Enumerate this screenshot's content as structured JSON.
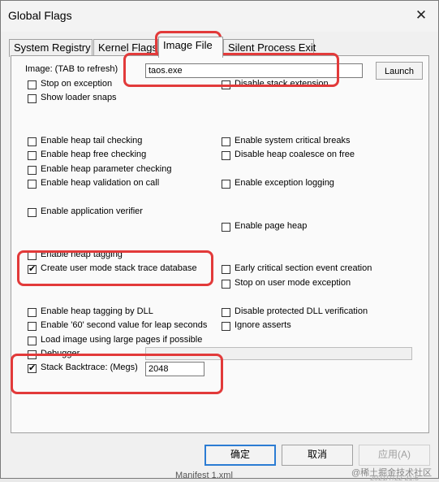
{
  "window": {
    "title": "Global Flags",
    "close_glyph": "✕"
  },
  "tabs": [
    {
      "label": "System Registry"
    },
    {
      "label": "Kernel Flags"
    },
    {
      "label": "Image File"
    },
    {
      "label": "Silent Process Exit"
    }
  ],
  "image": {
    "label": "Image: (TAB to refresh)",
    "value": "taos.exe",
    "launch": "Launch"
  },
  "flags": {
    "stop_on_exception": "Stop on exception",
    "show_loader_snaps": "Show loader snaps",
    "disable_stack_extension": "Disable stack extension",
    "heap_tail": "Enable heap tail checking",
    "heap_free": "Enable heap free checking",
    "heap_param": "Enable heap parameter checking",
    "heap_validation": "Enable heap validation on call",
    "app_verifier": "Enable application verifier",
    "heap_tagging": "Enable heap tagging",
    "ust": "Create user mode stack trace database",
    "heap_tagging_dll": "Enable heap tagging by DLL",
    "leap_seconds": "Enable '60' second value for leap seconds",
    "large_pages": "Load image using large pages if possible",
    "debugger": "Debugger",
    "stack_backtrace": "Stack Backtrace: (Megs)",
    "stack_backtrace_value": "2048",
    "system_critical": "Enable system critical breaks",
    "disable_coalesce": "Disable heap coalesce on free",
    "exception_logging": "Enable exception logging",
    "page_heap": "Enable page heap",
    "early_critical": "Early critical section event creation",
    "stop_user_mode": "Stop on user mode exception",
    "disable_protected_dll": "Disable protected DLL verification",
    "ignore_asserts": "Ignore asserts"
  },
  "buttons": {
    "ok": "确定",
    "cancel": "取消",
    "apply": "应用(A)"
  },
  "behind": {
    "file": "Manifest 1.xml",
    "date": "2021/7/22 21:5",
    "watermark": "@稀土掘金技术社区"
  },
  "colors": {
    "highlight": "#e23a3a",
    "default_button": "#2b7cd3"
  }
}
